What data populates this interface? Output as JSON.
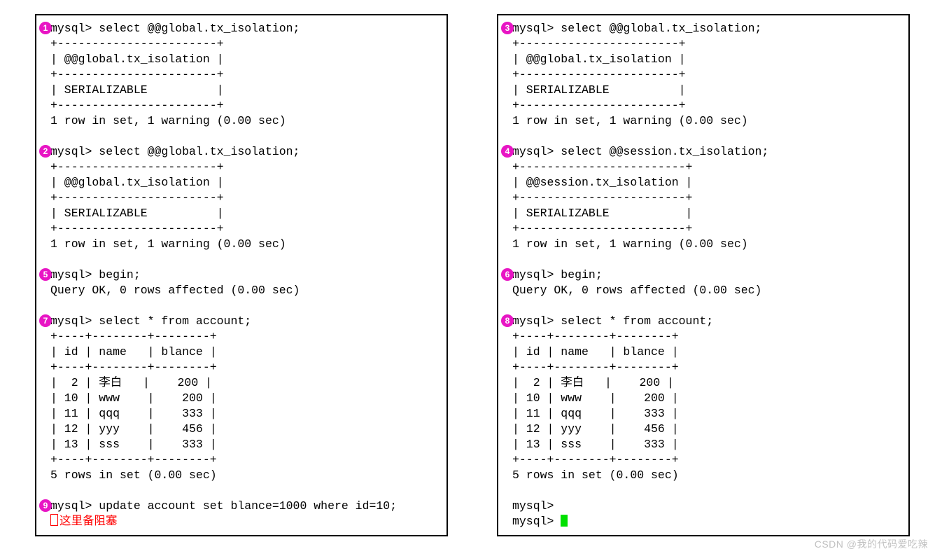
{
  "left": {
    "blocks": [
      {
        "badge": "1",
        "lines": [
          "mysql> select @@global.tx_isolation;",
          "+-----------------------+",
          "| @@global.tx_isolation |",
          "+-----------------------+",
          "| SERIALIZABLE          |",
          "+-----------------------+",
          "1 row in set, 1 warning (0.00 sec)",
          ""
        ]
      },
      {
        "badge": "2",
        "lines": [
          "mysql> select @@global.tx_isolation;",
          "+-----------------------+",
          "| @@global.tx_isolation |",
          "+-----------------------+",
          "| SERIALIZABLE          |",
          "+-----------------------+",
          "1 row in set, 1 warning (0.00 sec)",
          ""
        ]
      },
      {
        "badge": "5",
        "lines": [
          "mysql> begin;",
          "Query OK, 0 rows affected (0.00 sec)",
          ""
        ]
      },
      {
        "badge": "7",
        "lines": [
          "mysql> select * from account;",
          "+----+--------+--------+",
          "| id | name   | blance |",
          "+----+--------+--------+",
          "|  2 | 李白   |    200 |",
          "| 10 | www    |    200 |",
          "| 11 | qqq    |    333 |",
          "| 12 | yyy    |    456 |",
          "| 13 | sss    |    333 |",
          "+----+--------+--------+",
          "5 rows in set (0.00 sec)",
          ""
        ]
      },
      {
        "badge": "9",
        "lines": [
          "mysql> update account set blance=1000 where id=10;"
        ]
      }
    ],
    "note": "这里备阻塞"
  },
  "right": {
    "blocks": [
      {
        "badge": "3",
        "lines": [
          "mysql> select @@global.tx_isolation;",
          "+-----------------------+",
          "| @@global.tx_isolation |",
          "+-----------------------+",
          "| SERIALIZABLE          |",
          "+-----------------------+",
          "1 row in set, 1 warning (0.00 sec)",
          ""
        ]
      },
      {
        "badge": "4",
        "lines": [
          "mysql> select @@session.tx_isolation;",
          "+------------------------+",
          "| @@session.tx_isolation |",
          "+------------------------+",
          "| SERIALIZABLE           |",
          "+------------------------+",
          "1 row in set, 1 warning (0.00 sec)",
          ""
        ]
      },
      {
        "badge": "6",
        "lines": [
          "mysql> begin;",
          "Query OK, 0 rows affected (0.00 sec)",
          ""
        ]
      },
      {
        "badge": "8",
        "lines": [
          "mysql> select * from account;",
          "+----+--------+--------+",
          "| id | name   | blance |",
          "+----+--------+--------+",
          "|  2 | 李白   |    200 |",
          "| 10 | www    |    200 |",
          "| 11 | qqq    |    333 |",
          "| 12 | yyy    |    456 |",
          "| 13 | sss    |    333 |",
          "+----+--------+--------+",
          "5 rows in set (0.00 sec)",
          ""
        ]
      },
      {
        "badge": "",
        "lines": [
          "mysql>",
          "mysql> "
        ],
        "cursor": true
      }
    ]
  },
  "watermark": "CSDN @我的代码爱吃辣"
}
